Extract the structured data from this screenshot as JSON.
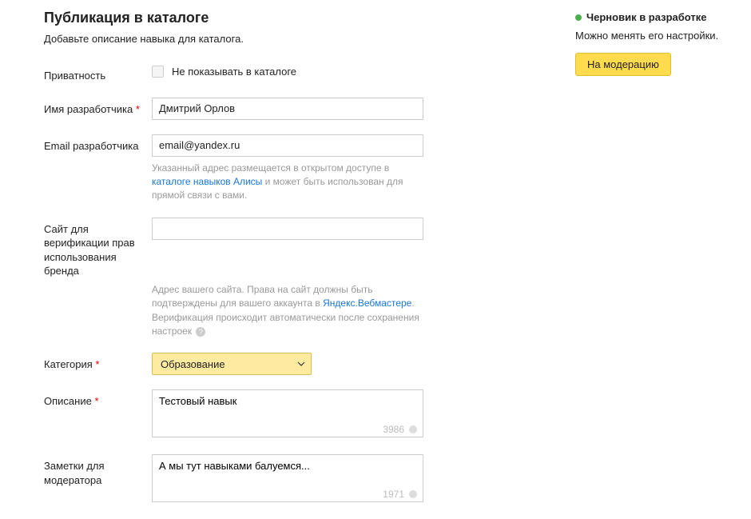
{
  "header": {
    "title": "Публикация в каталоге",
    "subtitle": "Добавьте описание навыка для каталога."
  },
  "form": {
    "privacy": {
      "label": "Приватность",
      "checkbox_label": "Не показывать в каталоге"
    },
    "developer_name": {
      "label": "Имя разработчика",
      "value": "Дмитрий Орлов"
    },
    "developer_email": {
      "label": "Email разработчика",
      "value": "email@yandex.ru",
      "help_pre": "Указанный адрес размещается в открытом доступе в ",
      "help_link": "каталоге навыков Алисы",
      "help_post": " и может быть использован для прямой связи с вами."
    },
    "brand_site": {
      "label": "Сайт для верификации прав использования бренда",
      "value": "",
      "help_pre": "Адрес вашего сайта. Права на сайт должны быть подтверждены для вашего аккаунта в ",
      "help_link": "Яндекс.Вебмастере",
      "help_post": ". Верификация происходит автоматически после сохранения настроек"
    },
    "category": {
      "label": "Категория",
      "value": "Образование"
    },
    "description": {
      "label": "Описание",
      "value": "Тестовый навык",
      "counter": "3986"
    },
    "moderator_notes": {
      "label": "Заметки для модератора",
      "value": "А мы тут навыками балуемся...",
      "counter": "1971"
    }
  },
  "sidebar": {
    "status": "Черновик в разработке",
    "status_sub": "Можно менять его настройки.",
    "moderation_btn": "На модерацию"
  }
}
